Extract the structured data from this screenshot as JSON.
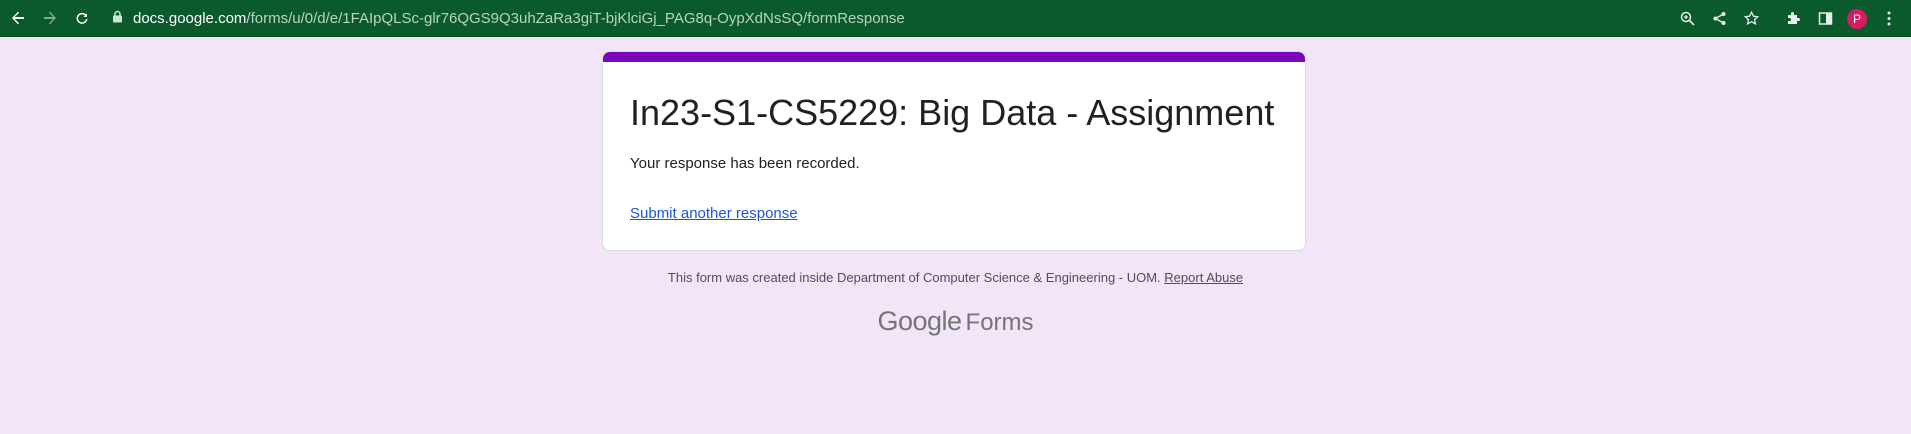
{
  "browser": {
    "url_domain": "docs.google.com",
    "url_path": "/forms/u/0/d/e/1FAIpQLSc-glr76QGS9Q3uhZaRa3giT-bjKlciGj_PAG8q-OypXdNsSQ/formResponse",
    "avatar_initial": "P",
    "icons": [
      "back-arrow-icon",
      "forward-arrow-icon",
      "reload-icon",
      "lock-icon",
      "zoom-icon",
      "share-icon",
      "star-icon",
      "extensions-icon",
      "side-panel-icon",
      "kebab-menu-icon"
    ]
  },
  "form": {
    "title": "In23-S1-CS5229: Big Data - Assignment",
    "message": "Your response has been recorded.",
    "submit_another": "Submit another response",
    "accent_color": "#7b06b8"
  },
  "footer": {
    "created_inside": "This form was created inside Department of Computer Science & Engineering - UOM.",
    "report_abuse": "Report Abuse",
    "brand_google": "Google",
    "brand_forms": "Forms"
  },
  "colors": {
    "toolbar": "#0b5a2c",
    "page_background": "#f1e5f7",
    "link": "#1a57d6"
  }
}
